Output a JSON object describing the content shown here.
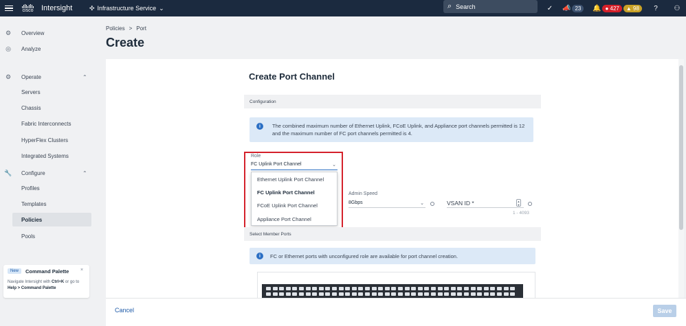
{
  "topbar": {
    "brand": "cisco",
    "app_name": "Intersight",
    "service": "Infrastructure Service",
    "search_placeholder": "Search",
    "announcements_count": "23",
    "alarms_critical": "427",
    "alarms_warning": "98",
    "icons": [
      "menu-icon",
      "service-icon",
      "search-icon",
      "check-circle-icon",
      "megaphone-icon",
      "bell-icon",
      "help-icon",
      "user-icon"
    ]
  },
  "sidebar": {
    "items": [
      {
        "label": "Overview",
        "icon": "gear-icon"
      },
      {
        "label": "Analyze",
        "icon": "analyze-icon"
      },
      {
        "label": "Operate",
        "icon": "gear-icon"
      },
      {
        "label": "Servers"
      },
      {
        "label": "Chassis"
      },
      {
        "label": "Fabric Interconnects"
      },
      {
        "label": "HyperFlex Clusters"
      },
      {
        "label": "Integrated Systems"
      },
      {
        "label": "Configure",
        "icon": "wrench-icon"
      },
      {
        "label": "Profiles"
      },
      {
        "label": "Templates"
      },
      {
        "label": "Policies"
      },
      {
        "label": "Pools"
      }
    ],
    "command_palette": {
      "badge": "New",
      "title": "Command Palette",
      "text_prefix": "Navigate Intersight with ",
      "shortcut": "Ctrl+K",
      "text_middle": " or go to ",
      "path": "Help > Command Palette"
    }
  },
  "header": {
    "breadcrumb": [
      "Policies",
      ">",
      "Port"
    ],
    "title": "Create"
  },
  "form": {
    "title": "Create Port Channel",
    "configuration_label": "Configuration",
    "info_text": "The combined maximum number of Ethernet Uplink, FCoE Uplink, and Appliance port channels permitted is 12 and the maximum number of FC port channels permitted is 4.",
    "role_label": "Role",
    "role_value": "FC Uplink Port Channel",
    "role_options": [
      "Ethernet Uplink Port Channel",
      "FC Uplink Port Channel",
      "FCoE Uplink Port Channel",
      "Appliance Port Channel"
    ],
    "admin_speed_label": "Admin Speed",
    "admin_speed_value": "8Gbps",
    "vsan_label": "VSAN ID *",
    "vsan_range": "1 - 4093",
    "member_ports_label": "Select Member Ports",
    "member_ports_info": "FC or Ethernet ports with unconfigured role are available for port channel creation."
  },
  "footer": {
    "cancel_label": "Cancel",
    "save_label": "Save"
  },
  "colors": {
    "topbar_bg": "#1b2a3f",
    "accent": "#2b6fc4",
    "highlight_border": "#d4202a",
    "critical_badge": "#d4202a",
    "warning_badge": "#c9a227"
  }
}
